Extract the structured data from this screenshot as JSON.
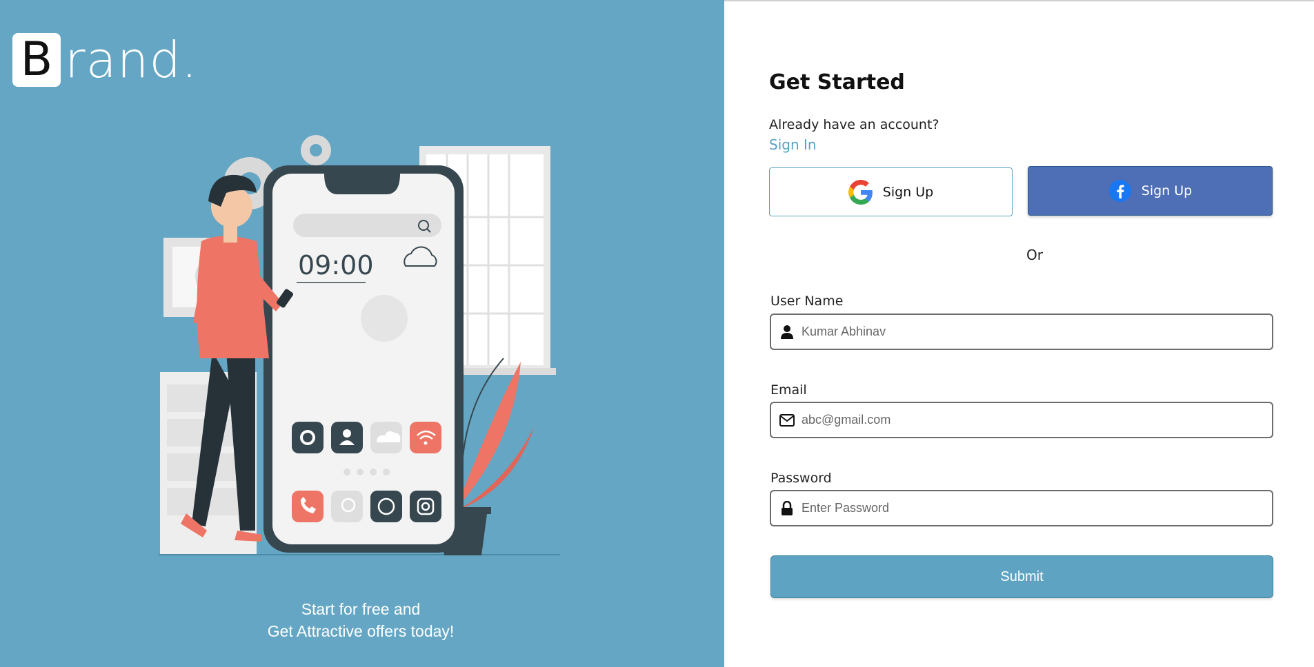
{
  "brand": {
    "initial": "B",
    "rest": "rand."
  },
  "illustration": {
    "clock": "09:00"
  },
  "tagline": {
    "line1": "Start for free and",
    "line2": "Get Attractive offers today!"
  },
  "form": {
    "title": "Get Started",
    "already_text": "Already have an account?",
    "signin_link": "Sign In",
    "google_button": "Sign Up",
    "facebook_button": "Sign Up",
    "or_text": "Or",
    "username": {
      "label": "User Name",
      "placeholder": "Kumar Abhinav"
    },
    "email": {
      "label": "Email",
      "placeholder": "abc@gmail.com"
    },
    "password": {
      "label": "Password",
      "placeholder": "Enter Password"
    },
    "submit": "Submit"
  },
  "colors": {
    "panel": "#64a6c3",
    "accent": "#5aa1c1",
    "facebook": "#4e6fb5",
    "coral": "#ee7566",
    "dark": "#37474f"
  },
  "icons": [
    "google-icon",
    "facebook-icon",
    "user-icon",
    "envelope-icon",
    "lock-icon"
  ]
}
